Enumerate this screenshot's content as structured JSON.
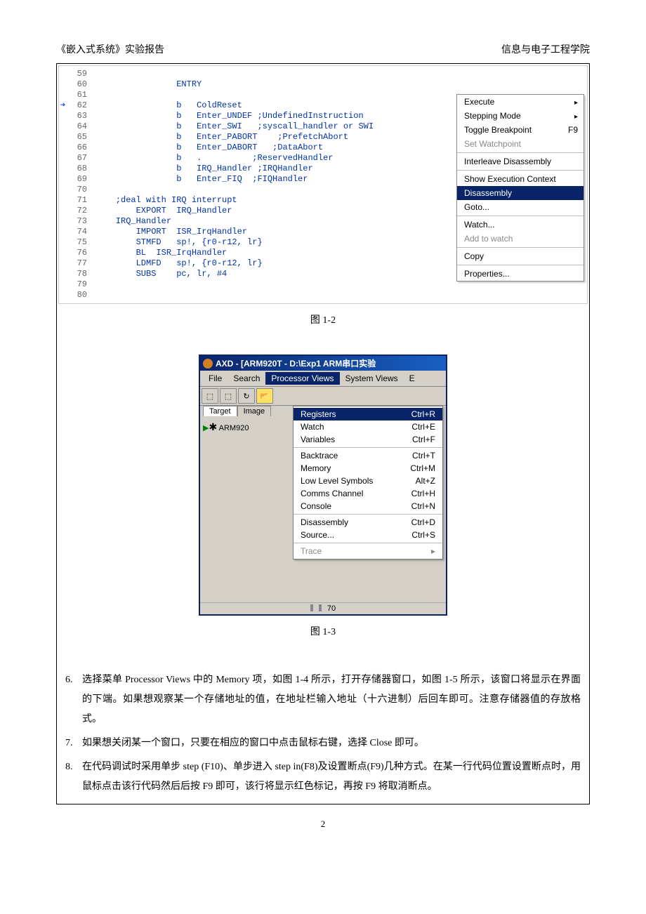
{
  "header": {
    "left": "《嵌入式系统》实验报告",
    "right": "信息与电子工程学院"
  },
  "code": {
    "lines": [
      {
        "n": "59",
        "t": ""
      },
      {
        "n": "60",
        "t": "                ENTRY"
      },
      {
        "n": "61",
        "t": ""
      },
      {
        "n": "62",
        "t": "                b   ColdReset",
        "pc": true
      },
      {
        "n": "63",
        "t": "                b   Enter_UNDEF ;UndefinedInstruction"
      },
      {
        "n": "64",
        "t": "                b   Enter_SWI   ;syscall_handler or SWI"
      },
      {
        "n": "65",
        "t": "                b   Enter_PABORT    ;PrefetchAbort"
      },
      {
        "n": "66",
        "t": "                b   Enter_DABORT   ;DataAbort"
      },
      {
        "n": "67",
        "t": "                b   .          ;ReservedHandler"
      },
      {
        "n": "68",
        "t": "                b   IRQ_Handler ;IRQHandler"
      },
      {
        "n": "69",
        "t": "                b   Enter_FIQ  ;FIQHandler"
      },
      {
        "n": "70",
        "t": ""
      },
      {
        "n": "71",
        "t": "    ;deal with IRQ interrupt"
      },
      {
        "n": "72",
        "t": "        EXPORT  IRQ_Handler"
      },
      {
        "n": "73",
        "t": "    IRQ_Handler"
      },
      {
        "n": "74",
        "t": "        IMPORT  ISR_IrqHandler"
      },
      {
        "n": "75",
        "t": "        STMFD   sp!, {r0-r12, lr}"
      },
      {
        "n": "76",
        "t": "        BL  ISR_IrqHandler"
      },
      {
        "n": "77",
        "t": "        LDMFD   sp!, {r0-r12, lr}"
      },
      {
        "n": "78",
        "t": "        SUBS    pc, lr, #4"
      },
      {
        "n": "79",
        "t": ""
      },
      {
        "n": "80",
        "t": ""
      }
    ]
  },
  "ctxmenu": [
    {
      "label": "Execute",
      "arrow": true,
      "u": "x"
    },
    {
      "label": "Stepping Mode",
      "arrow": true
    },
    {
      "label": "Toggle Breakpoint",
      "shortcut": "F9",
      "u": "B"
    },
    {
      "label": "Set Watchpoint",
      "disabled": true
    },
    {
      "sep": true
    },
    {
      "label": "Interleave Disassembly",
      "u": "I"
    },
    {
      "sep": true
    },
    {
      "label": "Show Execution Context",
      "u": "E"
    },
    {
      "label": "Disassembly",
      "selected": true,
      "u": "D"
    },
    {
      "label": "Goto...",
      "u": "G"
    },
    {
      "sep": true
    },
    {
      "label": "Watch...",
      "u": "W"
    },
    {
      "label": "Add to watch",
      "disabled": true,
      "u": "A"
    },
    {
      "sep": true
    },
    {
      "label": "Copy",
      "u": "C"
    },
    {
      "sep": true
    },
    {
      "label": "Properties..."
    }
  ],
  "fig1": "图 1-2",
  "axd": {
    "title": "AXD - [ARM920T - D:\\Exp1 ARM串口实验",
    "menubar": [
      "File",
      "Search",
      "Processor Views",
      "System Views",
      "E"
    ],
    "menubar_u": [
      "F",
      "",
      "P",
      "S",
      ""
    ],
    "active_menu_index": 2,
    "tabs": [
      "Target",
      "Image"
    ],
    "tree_node": "ARM920",
    "proc_menu": [
      {
        "label": "Registers",
        "shortcut": "Ctrl+R",
        "selected": true,
        "u": "R"
      },
      {
        "label": "Watch",
        "shortcut": "Ctrl+E",
        "u": "W"
      },
      {
        "label": "Variables",
        "shortcut": "Ctrl+F",
        "u": "V"
      },
      {
        "sep": true
      },
      {
        "label": "Backtrace",
        "shortcut": "Ctrl+T",
        "u": "B"
      },
      {
        "label": "Memory",
        "shortcut": "Ctrl+M",
        "u": "M"
      },
      {
        "label": "Low Level Symbols",
        "shortcut": "Alt+Z",
        "u": "L"
      },
      {
        "label": "Comms Channel",
        "shortcut": "Ctrl+H",
        "u": "C"
      },
      {
        "label": "Console",
        "shortcut": "Ctrl+N",
        "u": "o"
      },
      {
        "sep": true
      },
      {
        "label": "Disassembly",
        "shortcut": "Ctrl+D",
        "u": "D"
      },
      {
        "label": "Source...",
        "shortcut": "Ctrl+S",
        "u": "S"
      },
      {
        "sep": true
      },
      {
        "label": "Trace",
        "disabled": true,
        "arrow": true,
        "u": "T"
      }
    ],
    "step_val": "70"
  },
  "fig2": "图 1-3",
  "list": [
    {
      "n": "6.",
      "t": "选择菜单 Processor Views 中的 Memory 项，如图 1-4 所示，打开存储器窗口，如图 1-5 所示，该窗口将显示在界面的下端。如果想观察某一个存储地址的值，在地址栏输入地址（十六进制）后回车即可。注意存储器值的存放格式。"
    },
    {
      "n": "7.",
      "t": "如果想关闭某一个窗口，只要在相应的窗口中点击鼠标右键，选择 Close 即可。"
    },
    {
      "n": "8.",
      "t": "在代码调试时采用单步 step (F10)、单步进入 step in(F8)及设置断点(F9)几种方式。在某一行代码位置设置断点时，用鼠标点击该行代码然后后按 F9 即可，该行将显示红色标记，再按 F9 将取消断点。"
    }
  ],
  "pagenum": "2"
}
